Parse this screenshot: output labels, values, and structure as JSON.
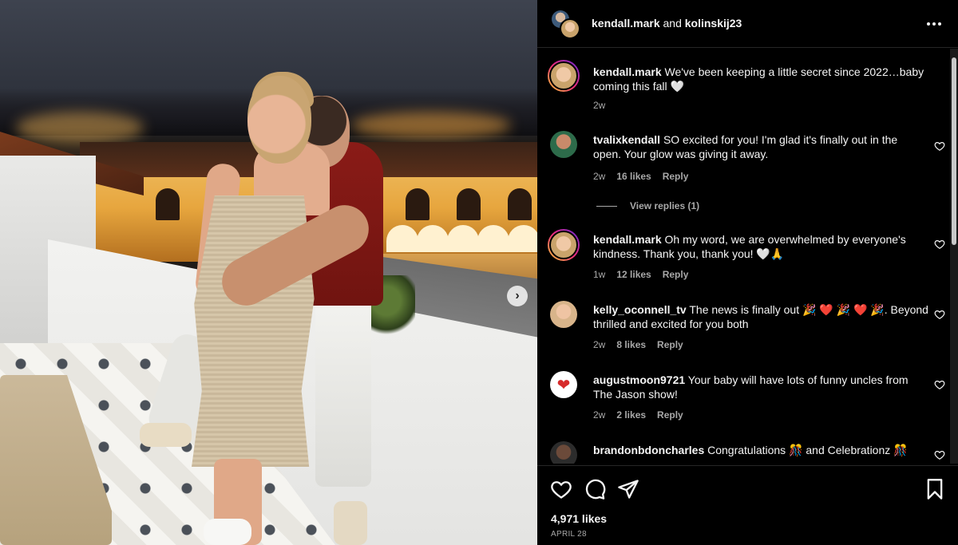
{
  "post": {
    "header": {
      "user1": "kendall.mark",
      "and": "and",
      "user2": "kolinskij23"
    },
    "caption": {
      "user": "kendall.mark",
      "text": "We've been keeping a little secret since 2022…baby coming this fall 🤍",
      "age": "2w"
    },
    "comments": [
      {
        "user": "tvalixkendall",
        "text": "SO excited for you! I'm glad it's finally out in the open. Your glow was giving it away.",
        "age": "2w",
        "likes": "16 likes",
        "reply": "Reply",
        "view_replies": "View replies (1)"
      },
      {
        "user": "kendall.mark",
        "text": "Oh my word, we are overwhelmed by everyone's kindness. Thank you, thank you! 🤍🙏",
        "age": "1w",
        "likes": "12 likes",
        "reply": "Reply"
      },
      {
        "user": "kelly_oconnell_tv",
        "text": "The news is finally out 🎉 ❤️ 🎉 ❤️ 🎉. Beyond thrilled and excited for you both",
        "age": "2w",
        "likes": "8 likes",
        "reply": "Reply"
      },
      {
        "user": "augustmoon9721",
        "text": "Your baby will have lots of funny uncles from The Jason show!",
        "age": "2w",
        "likes": "2 likes",
        "reply": "Reply"
      },
      {
        "user": "brandonbdoncharles",
        "text": "Congratulations 🎊 and Celebrationz 🎊"
      }
    ],
    "likes_count": "4,971 likes",
    "date": "APRIL 28"
  },
  "icons": {
    "like": "heart-icon",
    "comment": "comment-icon",
    "share": "share-icon",
    "save": "bookmark-icon",
    "more": "more-icon",
    "next": "chevron-right-icon"
  },
  "colors": {
    "background": "#000000",
    "text": "#f5f5f5",
    "secondary_text": "#a8a8a8",
    "divider": "#262626"
  }
}
